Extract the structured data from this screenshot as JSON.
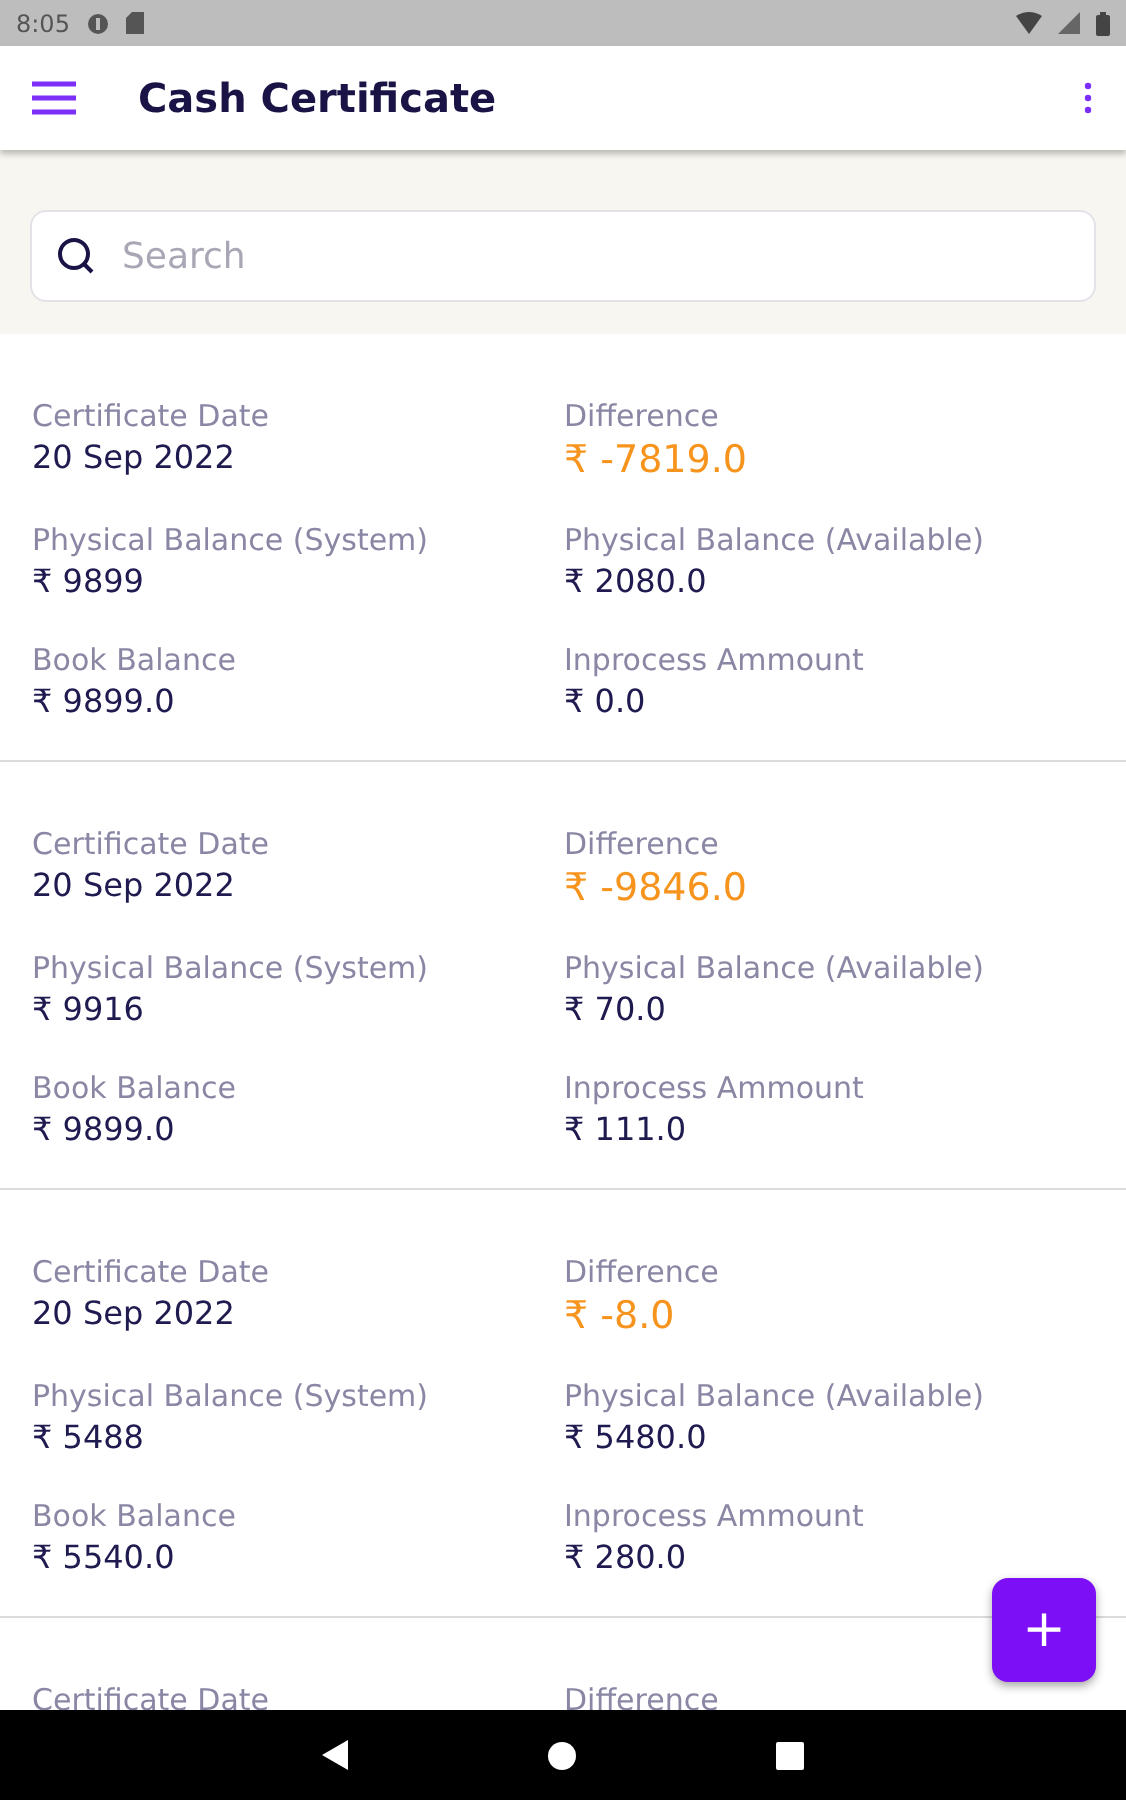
{
  "status_bar": {
    "time": "8:05"
  },
  "app_bar": {
    "title": "Cash Certificate"
  },
  "search": {
    "placeholder": "Search"
  },
  "cards": [
    {
      "fields": [
        {
          "label": "Certificate Date",
          "value": "20 Sep 2022",
          "kind": "plain"
        },
        {
          "label": "Difference",
          "value": "₹ -7819.0",
          "kind": "highlight"
        },
        {
          "label": "Physical Balance (System)",
          "value": "₹ 9899",
          "kind": "plain"
        },
        {
          "label": "Physical Balance (Available)",
          "value": "₹ 2080.0",
          "kind": "plain"
        },
        {
          "label": "Book Balance",
          "value": "₹ 9899.0",
          "kind": "plain"
        },
        {
          "label": "Inprocess Ammount",
          "value": "₹ 0.0",
          "kind": "plain"
        }
      ]
    },
    {
      "fields": [
        {
          "label": "Certificate Date",
          "value": "20 Sep 2022",
          "kind": "plain"
        },
        {
          "label": "Difference",
          "value": "₹ -9846.0",
          "kind": "highlight"
        },
        {
          "label": "Physical Balance (System)",
          "value": "₹ 9916",
          "kind": "plain"
        },
        {
          "label": "Physical Balance (Available)",
          "value": "₹ 70.0",
          "kind": "plain"
        },
        {
          "label": "Book Balance",
          "value": "₹ 9899.0",
          "kind": "plain"
        },
        {
          "label": "Inprocess Ammount",
          "value": "₹ 111.0",
          "kind": "plain"
        }
      ]
    },
    {
      "fields": [
        {
          "label": "Certificate Date",
          "value": "20 Sep 2022",
          "kind": "plain"
        },
        {
          "label": "Difference",
          "value": "₹ -8.0",
          "kind": "highlight"
        },
        {
          "label": "Physical Balance (System)",
          "value": "₹ 5488",
          "kind": "plain"
        },
        {
          "label": "Physical Balance (Available)",
          "value": "₹ 5480.0",
          "kind": "plain"
        },
        {
          "label": "Book Balance",
          "value": "₹ 5540.0",
          "kind": "plain"
        },
        {
          "label": "Inprocess Ammount",
          "value": "₹ 280.0",
          "kind": "plain"
        }
      ]
    },
    {
      "fields": [
        {
          "label": "Certificate Date"
        },
        {
          "label": "Difference"
        }
      ]
    }
  ],
  "fab": {
    "label": "+"
  }
}
